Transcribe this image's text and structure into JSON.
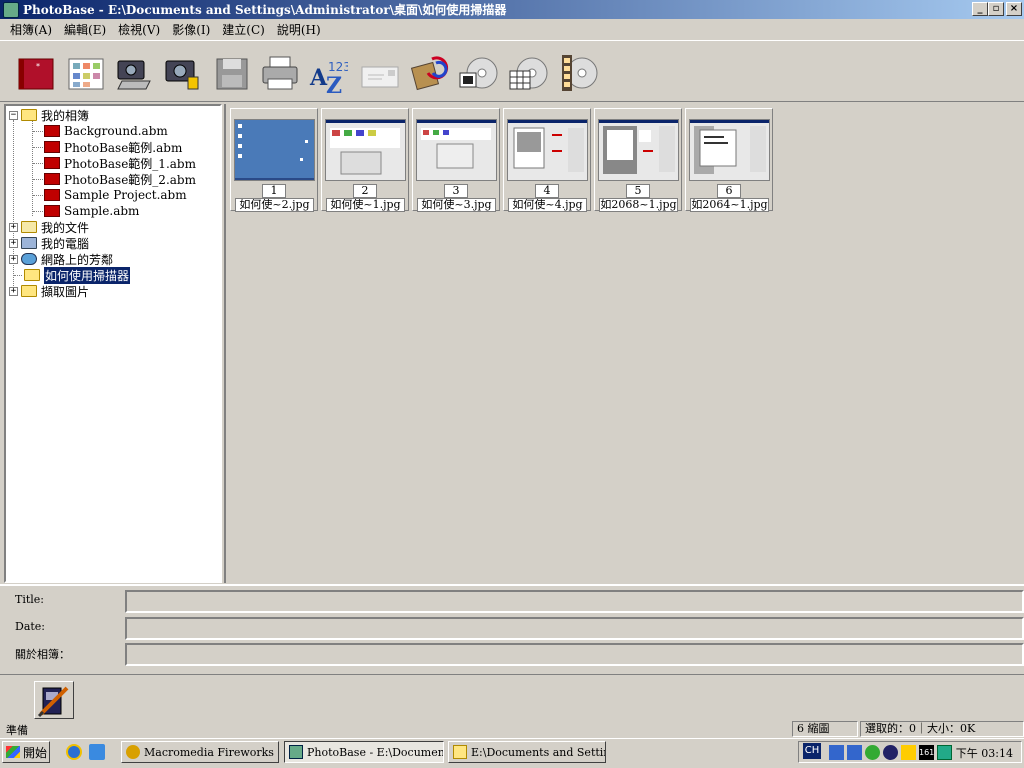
{
  "window": {
    "title": "PhotoBase - E:\\Documents and Settings\\Administrator\\桌面\\如何使用掃描器",
    "min": "_",
    "max": "▫",
    "close": "×"
  },
  "menu": [
    "相簿(A)",
    "編輯(E)",
    "檢視(V)",
    "影像(I)",
    "建立(C)",
    "說明(H)"
  ],
  "toolbar_icons": [
    "album-icon",
    "thumbnail-grid-icon",
    "scanner-icon",
    "camera-icon",
    "save-icon",
    "print-icon",
    "sort-az-icon",
    "email-icon",
    "photo-edit-icon",
    "cd-slideshow-icon",
    "cd-calendar-icon",
    "video-cd-icon"
  ],
  "tree": {
    "root": "我的相簿",
    "albums": [
      "Background.abm",
      "PhotoBase範例.abm",
      "PhotoBase範例_1.abm",
      "PhotoBase範例_2.abm",
      "Sample Project.abm",
      "Sample.abm"
    ],
    "my_documents": "我的文件",
    "my_computer": "我的電腦",
    "network": "網路上的芳鄰",
    "scanner_folder": "如何使用掃描器",
    "capture": "擷取圖片"
  },
  "thumbnails": [
    {
      "num": "1",
      "name": "如何使~2.jpg"
    },
    {
      "num": "2",
      "name": "如何使~1.jpg"
    },
    {
      "num": "3",
      "name": "如何使~3.jpg"
    },
    {
      "num": "4",
      "name": "如何使~4.jpg"
    },
    {
      "num": "5",
      "name": "如2068~1.jpg"
    },
    {
      "num": "6",
      "name": "如2064~1.jpg"
    }
  ],
  "info": {
    "title_label": "Title:",
    "date_label": "Date:",
    "about_label": "關於相簿："
  },
  "status": {
    "ready": "準備",
    "count": "6 縮圖",
    "selection": "選取的：0｜大小：0K"
  },
  "taskbar": {
    "start": "開始",
    "tasks": [
      "Macromedia Fireworks M...",
      "PhotoBase - E:\\Document...",
      "E:\\Documents and Setting..."
    ],
    "ime": "CH",
    "battery": "161",
    "clock": "下午 03:14"
  }
}
